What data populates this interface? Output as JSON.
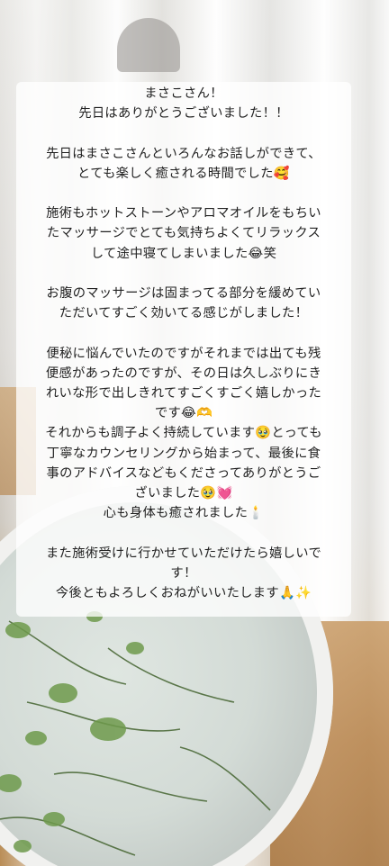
{
  "message": {
    "lines": [
      "まさこさん！",
      "先日はありがとうございました！！",
      "",
      "先日はまさこさんといろんなお話しができて、",
      "とても楽しく癒される時間でした🥰",
      "",
      "施術もホットストーンやアロマオイルをもちい",
      "たマッサージでとても気持ちよくてリラックス",
      "して途中寝てしまいました😂笑",
      "",
      "お腹のマッサージは固まってる部分を緩めてい",
      "ただいてすごく効いてる感じがしました！",
      "",
      "便秘に悩んでいたのですがそれまでは出ても残",
      "便感があったのですが、その日は久しぶりにき",
      "れいな形で出しきれてすごくすごく嬉しかった",
      "です😂🫶",
      "それからも調子よく持続しています🥹とっても",
      "丁寧なカウンセリングから始まって、最後に食",
      "事のアドバイスなどもくださってありがとうご",
      "ざいました🥹💓",
      "心も身体も癒されました🕯️",
      "",
      "また施術受けに行かせていただけたら嬉しいで",
      "す！",
      "今後ともよろしくおねがいいたします🙏✨"
    ]
  }
}
